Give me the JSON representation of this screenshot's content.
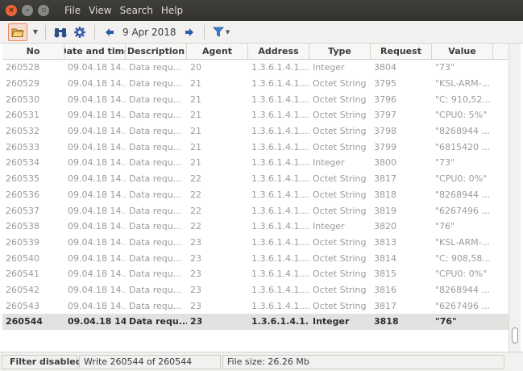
{
  "window": {
    "controls": [
      "close",
      "minimize",
      "maximize"
    ]
  },
  "menu": {
    "items": [
      "File",
      "View",
      "Search",
      "Help"
    ]
  },
  "toolbar": {
    "date_label": "9 Apr 2018",
    "icons": [
      "open-folder-icon",
      "dropdown-arrow-icon",
      "binoculars-icon",
      "gear-icon",
      "arrow-left-icon",
      "arrow-right-icon",
      "filter-icon"
    ]
  },
  "table": {
    "columns": [
      "No",
      "Date and time",
      "Description",
      "Agent",
      "Address",
      "Type",
      "Request",
      "Value"
    ],
    "rows": [
      {
        "no": "260528",
        "datetime": "09.04.18 14...",
        "description": "Data requ...",
        "agent": "20",
        "address": "1.3.6.1.4.1....",
        "type": "Integer",
        "request": "3804",
        "value": "\"73\""
      },
      {
        "no": "260529",
        "datetime": "09.04.18 14...",
        "description": "Data requ...",
        "agent": "21",
        "address": "1.3.6.1.4.1....",
        "type": "Octet String",
        "request": "3795",
        "value": "\"KSL-ARM-..."
      },
      {
        "no": "260530",
        "datetime": "09.04.18 14...",
        "description": "Data requ...",
        "agent": "21",
        "address": "1.3.6.1.4.1....",
        "type": "Octet String",
        "request": "3796",
        "value": "\"C: 910,52..."
      },
      {
        "no": "260531",
        "datetime": "09.04.18 14...",
        "description": "Data requ...",
        "agent": "21",
        "address": "1.3.6.1.4.1....",
        "type": "Octet String",
        "request": "3797",
        "value": "\"CPU0: 5%\""
      },
      {
        "no": "260532",
        "datetime": "09.04.18 14...",
        "description": "Data requ...",
        "agent": "21",
        "address": "1.3.6.1.4.1....",
        "type": "Octet String",
        "request": "3798",
        "value": "\"8268944 ..."
      },
      {
        "no": "260533",
        "datetime": "09.04.18 14...",
        "description": "Data requ...",
        "agent": "21",
        "address": "1.3.6.1.4.1....",
        "type": "Octet String",
        "request": "3799",
        "value": "\"6815420 ..."
      },
      {
        "no": "260534",
        "datetime": "09.04.18 14...",
        "description": "Data requ...",
        "agent": "21",
        "address": "1.3.6.1.4.1....",
        "type": "Integer",
        "request": "3800",
        "value": "\"73\""
      },
      {
        "no": "260535",
        "datetime": "09.04.18 14...",
        "description": "Data requ...",
        "agent": "22",
        "address": "1.3.6.1.4.1....",
        "type": "Octet String",
        "request": "3817",
        "value": "\"CPU0: 0%\""
      },
      {
        "no": "260536",
        "datetime": "09.04.18 14...",
        "description": "Data requ...",
        "agent": "22",
        "address": "1.3.6.1.4.1....",
        "type": "Octet String",
        "request": "3818",
        "value": "\"8268944 ..."
      },
      {
        "no": "260537",
        "datetime": "09.04.18 14...",
        "description": "Data requ...",
        "agent": "22",
        "address": "1.3.6.1.4.1....",
        "type": "Octet String",
        "request": "3819",
        "value": "\"6267496 ..."
      },
      {
        "no": "260538",
        "datetime": "09.04.18 14...",
        "description": "Data requ...",
        "agent": "22",
        "address": "1.3.6.1.4.1....",
        "type": "Integer",
        "request": "3820",
        "value": "\"76\""
      },
      {
        "no": "260539",
        "datetime": "09.04.18 14...",
        "description": "Data requ...",
        "agent": "23",
        "address": "1.3.6.1.4.1....",
        "type": "Octet String",
        "request": "3813",
        "value": "\"KSL-ARM-..."
      },
      {
        "no": "260540",
        "datetime": "09.04.18 14...",
        "description": "Data requ...",
        "agent": "23",
        "address": "1.3.6.1.4.1....",
        "type": "Octet String",
        "request": "3814",
        "value": "\"C: 908,58..."
      },
      {
        "no": "260541",
        "datetime": "09.04.18 14...",
        "description": "Data requ...",
        "agent": "23",
        "address": "1.3.6.1.4.1....",
        "type": "Octet String",
        "request": "3815",
        "value": "\"CPU0: 0%\""
      },
      {
        "no": "260542",
        "datetime": "09.04.18 14...",
        "description": "Data requ...",
        "agent": "23",
        "address": "1.3.6.1.4.1....",
        "type": "Octet String",
        "request": "3816",
        "value": "\"8268944 ..."
      },
      {
        "no": "260543",
        "datetime": "09.04.18 14...",
        "description": "Data requ...",
        "agent": "23",
        "address": "1.3.6.1.4.1....",
        "type": "Octet String",
        "request": "3817",
        "value": "\"6267496 ..."
      },
      {
        "no": "260544",
        "datetime": "09.04.18 14...",
        "description": "Data requ...",
        "agent": "23",
        "address": "1.3.6.1.4.1....",
        "type": "Integer",
        "request": "3818",
        "value": "\"76\"",
        "selected": true
      }
    ]
  },
  "statusbar": {
    "filter_label": "Filter disabled",
    "write_label": "Write 260544 of 260544",
    "filesize_label": "File size: 26.26 Mb"
  },
  "colors": {
    "titlebar": "#3c3b37",
    "close_button": "#e9643a",
    "accent_blue": "#3d74c9",
    "selected_row": "#e2e2e1"
  }
}
